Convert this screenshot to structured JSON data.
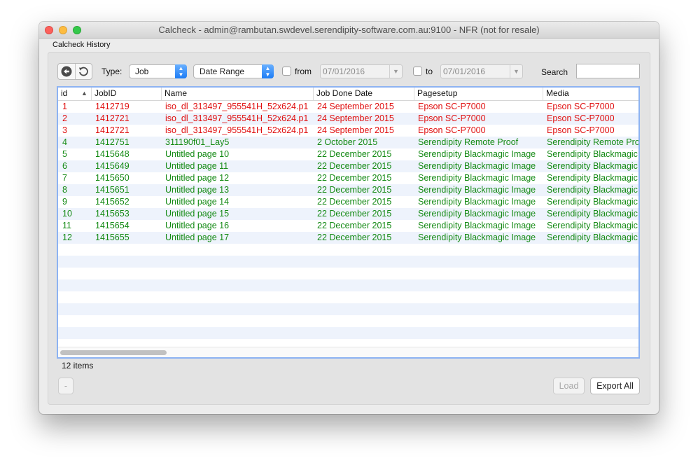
{
  "window": {
    "title": "Calcheck - admin@rambutan.swdevel.serendipity-software.com.au:9100 - NFR (not for resale)"
  },
  "section_label": "Calcheck History",
  "toolbar": {
    "type_label": "Type:",
    "type_value": "Job",
    "range_value": "Date Range",
    "from_label": "from",
    "from_date": "07/01/2016",
    "to_label": "to",
    "to_date": "07/01/2016",
    "search_label": "Search",
    "search_value": ""
  },
  "table": {
    "columns": [
      "id",
      "JobID",
      "Name",
      "Job Done Date",
      "Pagesetup",
      "Media"
    ],
    "rows": [
      {
        "status": "red",
        "cells": [
          "1",
          "1412719",
          "iso_dl_313497_955541H_52x624.p1",
          "24 September 2015",
          "Epson SC-P7000",
          "Epson SC-P7000"
        ]
      },
      {
        "status": "red",
        "cells": [
          "2",
          "1412721",
          "iso_dl_313497_955541H_52x624.p1",
          "24 September 2015",
          "Epson SC-P7000",
          "Epson SC-P7000"
        ]
      },
      {
        "status": "red",
        "cells": [
          "3",
          "1412721",
          "iso_dl_313497_955541H_52x624.p1",
          "24 September 2015",
          "Epson SC-P7000",
          "Epson SC-P7000"
        ]
      },
      {
        "status": "green",
        "cells": [
          "4",
          "1412751",
          "311190f01_Lay5",
          "2 October 2015",
          "Serendipity Remote Proof",
          "Serendipity Remote Pro"
        ]
      },
      {
        "status": "green",
        "cells": [
          "5",
          "1415648",
          "Untitled page 10",
          "22 December 2015",
          "Serendipity Blackmagic Image",
          "Serendipity Blackmagic"
        ]
      },
      {
        "status": "green",
        "cells": [
          "6",
          "1415649",
          "Untitled page 11",
          "22 December 2015",
          "Serendipity Blackmagic Image",
          "Serendipity Blackmagic"
        ]
      },
      {
        "status": "green",
        "cells": [
          "7",
          "1415650",
          "Untitled page 12",
          "22 December 2015",
          "Serendipity Blackmagic Image",
          "Serendipity Blackmagic"
        ]
      },
      {
        "status": "green",
        "cells": [
          "8",
          "1415651",
          "Untitled page 13",
          "22 December 2015",
          "Serendipity Blackmagic Image",
          "Serendipity Blackmagic"
        ]
      },
      {
        "status": "green",
        "cells": [
          "9",
          "1415652",
          "Untitled page 14",
          "22 December 2015",
          "Serendipity Blackmagic Image",
          "Serendipity Blackmagic"
        ]
      },
      {
        "status": "green",
        "cells": [
          "10",
          "1415653",
          "Untitled page 15",
          "22 December 2015",
          "Serendipity Blackmagic Image",
          "Serendipity Blackmagic"
        ]
      },
      {
        "status": "green",
        "cells": [
          "11",
          "1415654",
          "Untitled page 16",
          "22 December 2015",
          "Serendipity Blackmagic Image",
          "Serendipity Blackmagic"
        ]
      },
      {
        "status": "green",
        "cells": [
          "12",
          "1415655",
          "Untitled page 17",
          "22 December 2015",
          "Serendipity Blackmagic Image",
          "Serendipity Blackmagic"
        ]
      }
    ],
    "empty_rows": 8
  },
  "footer": {
    "count_text": "12 items",
    "remove_label": "-",
    "load_label": "Load",
    "export_label": "Export All"
  },
  "colors": {
    "error": "#e01010",
    "ok": "#148a14",
    "accent": "#1c7cf5"
  },
  "icons": [
    "back-circle-arrow-icon",
    "refresh-icon",
    "sort-ascending-icon",
    "checkbox-icon",
    "dropdown-chevron-icon"
  ]
}
